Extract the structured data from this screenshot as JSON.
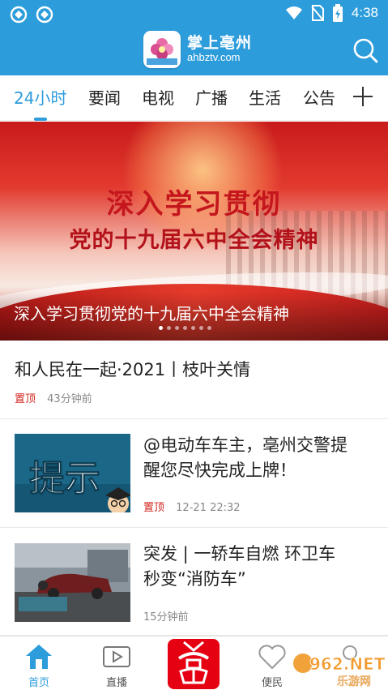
{
  "status_bar": {
    "time": "4:38"
  },
  "header": {
    "brand_name": "掌上亳州",
    "brand_url": "ahbztv.com"
  },
  "tabs": [
    {
      "label": "24小时",
      "active": true
    },
    {
      "label": "要闻"
    },
    {
      "label": "电视"
    },
    {
      "label": "广播"
    },
    {
      "label": "生活"
    },
    {
      "label": "公告"
    }
  ],
  "banner": {
    "headline_line1": "深入学习贯彻",
    "headline_line2": "党的十九届六中全会精神",
    "caption": "深入学习贯彻党的十九届六中全会精神",
    "slide_count": 7,
    "active_slide": 1
  },
  "news": [
    {
      "title": "和人民在一起·2021丨枝叶关情",
      "pin_label": "置顶",
      "time": "43分钟前"
    },
    {
      "title_line1": "@电动车车主，亳州交警提",
      "title_line2": "醒您尽快完成上牌！",
      "thumb_text": "提示",
      "pin_label": "置顶",
      "time": "12-21 22:32"
    },
    {
      "title_line1": "突发 | 一轿车自燃 环卫车",
      "title_line2": "秒变“消防车”",
      "time": "15分钟前"
    }
  ],
  "bottom_nav": [
    {
      "label": "首页",
      "active": true
    },
    {
      "label": "直播"
    },
    {
      "label": "便民"
    }
  ],
  "watermark": {
    "brand": "962.NET",
    "sub": "乐游网"
  },
  "colors": {
    "primary": "#2d9cdb",
    "pin": "#d0261f",
    "center_button": "#e50012"
  }
}
